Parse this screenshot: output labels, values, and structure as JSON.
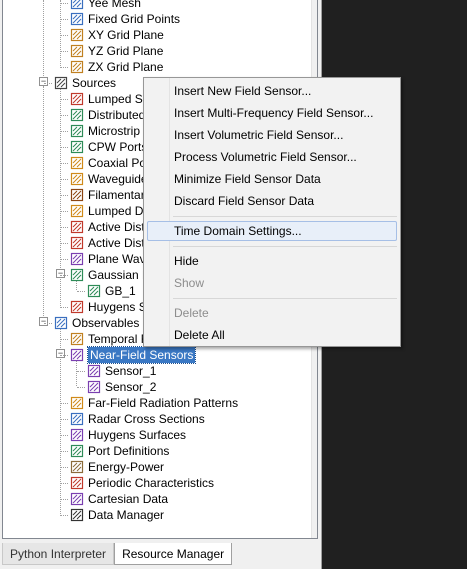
{
  "tree": {
    "items": [
      {
        "label": "Yee Mesh",
        "icon": "yee-mesh-icon",
        "color": "#3a6fbf"
      },
      {
        "label": "Fixed Grid Points",
        "icon": "fixed-grid-icon",
        "color": "#3a6fbf"
      },
      {
        "label": "XY Grid Plane",
        "icon": "xy-grid-plane-icon",
        "color": "#c08020"
      },
      {
        "label": "YZ Grid Plane",
        "icon": "yz-grid-plane-icon",
        "color": "#c08020"
      },
      {
        "label": "ZX Grid Plane",
        "icon": "zx-grid-plane-icon",
        "color": "#c08020"
      },
      {
        "label": "Sources",
        "icon": "sources-icon",
        "color": "#444444"
      },
      {
        "label": "Lumped So",
        "icon": "lumped-source-icon",
        "color": "#c0392b"
      },
      {
        "label": "Distributed",
        "icon": "distributed-source-icon",
        "color": "#2e8b57"
      },
      {
        "label": "Microstrip F",
        "icon": "microstrip-port-icon",
        "color": "#2e8b57"
      },
      {
        "label": "CPW Ports",
        "icon": "cpw-port-icon",
        "color": "#2e8b57"
      },
      {
        "label": "Coaxial Por",
        "icon": "coaxial-port-icon",
        "color": "#d08a1a"
      },
      {
        "label": "Waveguide",
        "icon": "waveguide-source-icon",
        "color": "#d08a1a"
      },
      {
        "label": "Filamentary",
        "icon": "filamentary-source-icon",
        "color": "#8b4513"
      },
      {
        "label": "Lumped De",
        "icon": "lumped-device-icon",
        "color": "#d08a1a"
      },
      {
        "label": "Active Distr",
        "icon": "active-distributed-icon",
        "color": "#c0392b"
      },
      {
        "label": "Active Distr",
        "icon": "active-distributed-icon-2",
        "color": "#c0392b"
      },
      {
        "label": "Plane Wav",
        "icon": "plane-wave-icon",
        "color": "#7a3fb0"
      },
      {
        "label": "Gaussian B",
        "icon": "gaussian-beam-icon",
        "color": "#2e8b57"
      },
      {
        "label": "GB_1",
        "icon": "gaussian-beam-item-icon",
        "color": "#2e8b57"
      },
      {
        "label": "Huygens Sc",
        "icon": "huygens-source-icon",
        "color": "#c0392b"
      },
      {
        "label": "Observables",
        "icon": "observables-icon",
        "color": "#3a6fbf"
      },
      {
        "label": "Temporal F",
        "icon": "temporal-sensor-icon",
        "color": "#c08020"
      },
      {
        "label": "Near-Field Sensors",
        "icon": "near-field-sensors-icon",
        "color": "#7a3fb0"
      },
      {
        "label": "Sensor_1",
        "icon": "sensor-item-icon",
        "color": "#7a3fb0"
      },
      {
        "label": "Sensor_2",
        "icon": "sensor-item-icon-2",
        "color": "#7a3fb0"
      },
      {
        "label": "Far-Field Radiation Patterns",
        "icon": "far-field-icon",
        "color": "#d08a1a"
      },
      {
        "label": "Radar Cross Sections",
        "icon": "rcs-icon",
        "color": "#3a6fbf"
      },
      {
        "label": "Huygens Surfaces",
        "icon": "huygens-surface-icon",
        "color": "#7a3fb0"
      },
      {
        "label": "Port Definitions",
        "icon": "port-definitions-icon",
        "color": "#2e8b57"
      },
      {
        "label": "Energy-Power",
        "icon": "energy-power-icon",
        "color": "#8b6b3a"
      },
      {
        "label": "Periodic Characteristics",
        "icon": "periodic-icon",
        "color": "#c0392b"
      },
      {
        "label": "Cartesian Data",
        "icon": "cartesian-data-icon",
        "color": "#7a3fb0"
      },
      {
        "label": "Data Manager",
        "icon": "data-manager-icon",
        "color": "#333333"
      }
    ]
  },
  "tabs": [
    {
      "label": "Python Interpreter",
      "active": false
    },
    {
      "label": "Resource Manager",
      "active": true
    }
  ],
  "context_menu": {
    "items": [
      {
        "label": "Insert New Field Sensor...",
        "enabled": true
      },
      {
        "label": "Insert Multi-Frequency Field Sensor...",
        "enabled": true
      },
      {
        "label": "Insert Volumetric Field Sensor...",
        "enabled": true
      },
      {
        "label": "Process Volumetric Field Sensor...",
        "enabled": true
      },
      {
        "label": "Minimize Field Sensor Data",
        "enabled": true
      },
      {
        "label": "Discard Field Sensor Data",
        "enabled": true
      },
      {
        "label": "Time Domain Settings...",
        "enabled": true,
        "highlighted": true
      },
      {
        "label": "Hide",
        "enabled": true
      },
      {
        "label": "Show",
        "enabled": false
      },
      {
        "label": "Delete",
        "enabled": false
      },
      {
        "label": "Delete All",
        "enabled": true
      }
    ]
  },
  "colors": {
    "selection": "#3a78c4",
    "menu_highlight": "#e8eff9",
    "disabled_text": "#8d8d8d"
  }
}
